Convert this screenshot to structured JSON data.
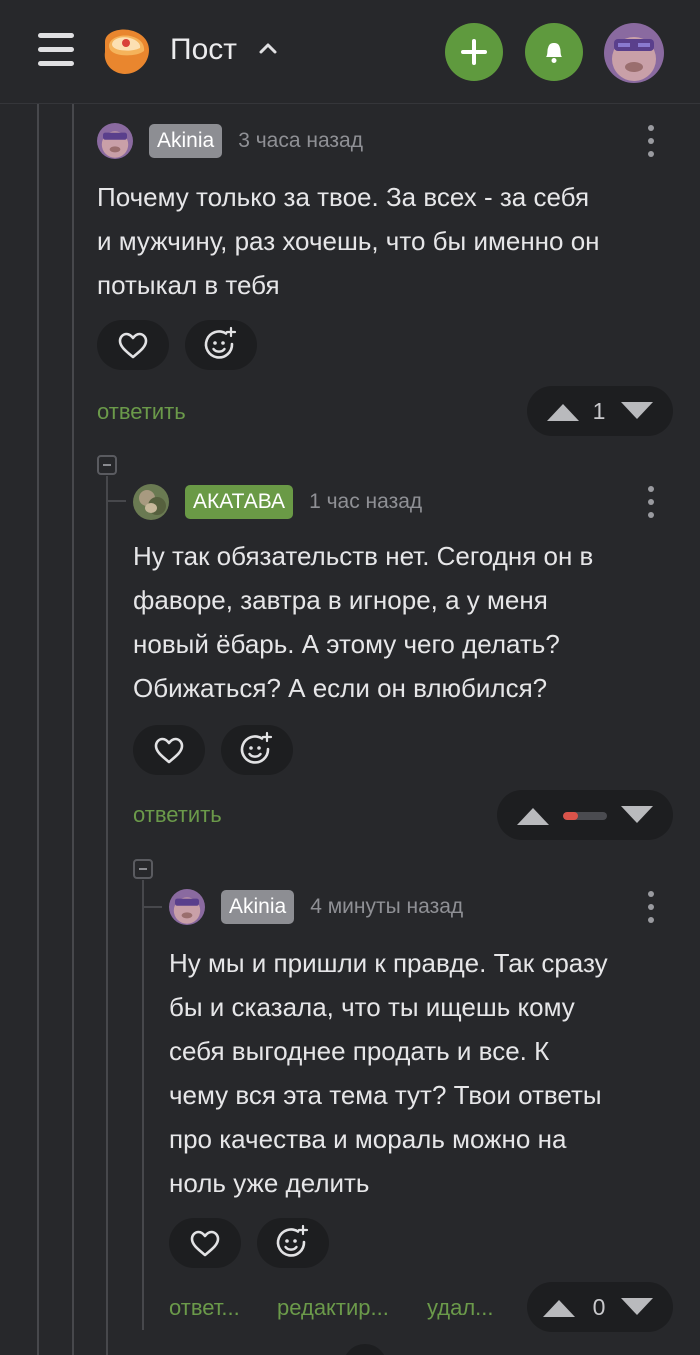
{
  "header": {
    "title": "Пост",
    "icons": [
      "menu-icon",
      "pikabu-logo",
      "chevron-up-icon",
      "plus-icon",
      "bell-icon",
      "avatar"
    ],
    "accent": "#5f9a3e"
  },
  "comments": [
    {
      "author": "Akinia",
      "time": "3 часа назад",
      "text_lines": [
        "Почему только за твое. За всех - за себя",
        "и мужчину, раз хочешь, что бы именно он",
        "потыкал в тебя"
      ],
      "reply_label": "ответить",
      "score": "1"
    },
    {
      "author": "АКАТАВА",
      "time": "1 час назад",
      "text_lines": [
        "Ну так обязательств нет. Сегодня он в",
        "фаворе, завтра в игноре, а у меня",
        "новый ёбарь. А этому чего делать?",
        "Обижаться? А если он влюбился?"
      ],
      "reply_label": "ответить",
      "rating_negative_fraction": 0.35
    },
    {
      "author": "Akinia",
      "time": "4 минуты назад",
      "text_lines": [
        "Ну мы и пришли к правде. Так сразу",
        "бы и сказала, что ты ищешь кому",
        "себя выгоднее продать и все. К",
        "чему вся эта тема тут? Твои ответы",
        "про качества и мораль можно на",
        "ноль уже делить"
      ],
      "reply_label": "ответ...",
      "edit_label": "редактир...",
      "delete_label": "удал...",
      "score": "0"
    }
  ]
}
